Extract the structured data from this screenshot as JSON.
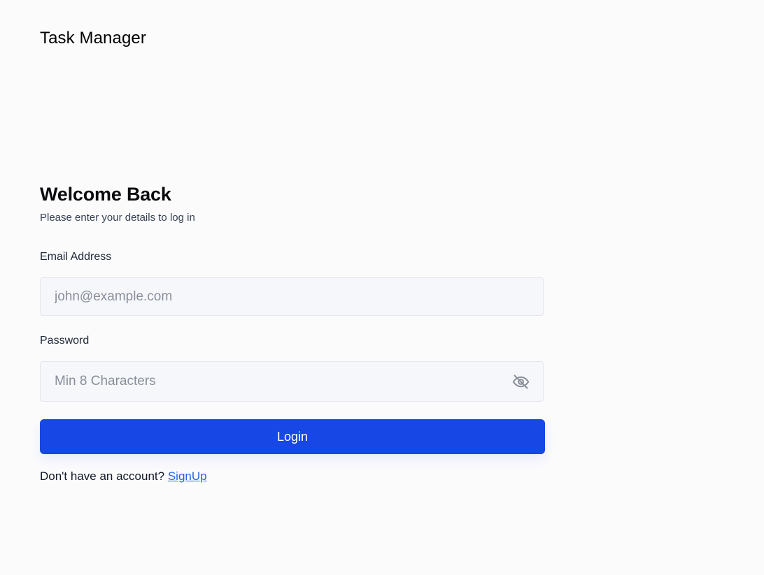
{
  "app": {
    "title": "Task Manager"
  },
  "login": {
    "heading": "Welcome Back",
    "subheading": "Please enter your details to log in",
    "email": {
      "label": "Email Address",
      "value": "",
      "placeholder": "john@example.com"
    },
    "password": {
      "label": "Password",
      "value": "",
      "placeholder": "Min 8 Characters",
      "visibility_icon": "eye-off-icon"
    },
    "submit_label": "Login",
    "signup_prompt": "Don't have an account?",
    "signup_label": "SignUp"
  },
  "colors": {
    "background": "#fbfbfc",
    "input_background": "#f5f7fb",
    "input_border": "#e4e7ec",
    "button_primary": "#1747e5",
    "link": "#2563eb",
    "icon_muted": "#8a8f99"
  }
}
